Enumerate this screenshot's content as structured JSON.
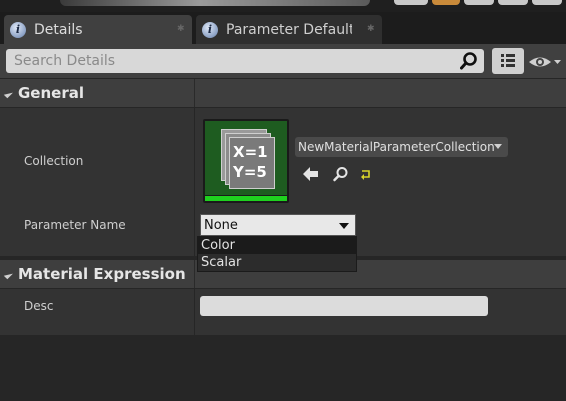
{
  "tabs": [
    {
      "label": "Details",
      "active": true
    },
    {
      "label": "Parameter Defaults",
      "active": false
    }
  ],
  "toolbar": {
    "search_placeholder": "Search Details",
    "icons": [
      "search-icon",
      "grid-view-icon",
      "eye-icon"
    ]
  },
  "sections": {
    "general": {
      "title": "General",
      "collection_label": "Collection",
      "collection_value": "NewMaterialParameterCollection",
      "thumbnail_lines": [
        "X=1",
        "Y=5"
      ],
      "collection_icons": [
        "use-selected-arrow-icon",
        "browse-magnifier-icon",
        "reset-icon"
      ],
      "parameter_name_label": "Parameter Name",
      "parameter_name_value": "None",
      "parameter_options": [
        "Color",
        "Scalar"
      ]
    },
    "material_expression": {
      "title": "Material Expression",
      "desc_label": "Desc",
      "desc_value": ""
    }
  },
  "colors": {
    "panel_bg": "#262626",
    "section_header_bg": "#3e3e3e",
    "row_bg": "#333333",
    "thumbnail_green": "#1e5c20",
    "thumbnail_bar": "#1fd11f"
  }
}
